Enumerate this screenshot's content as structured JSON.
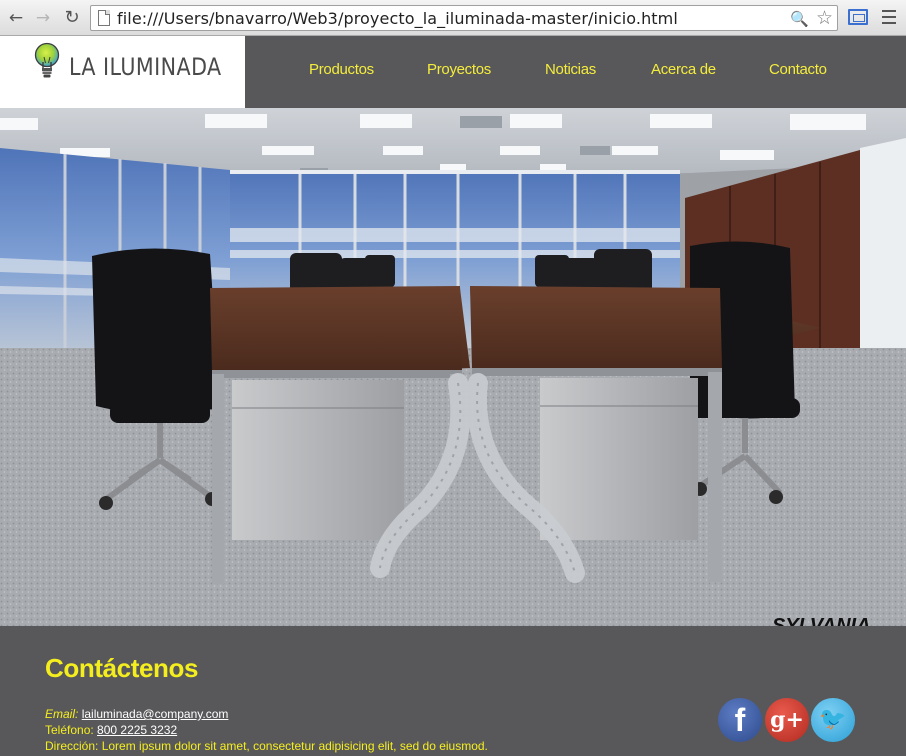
{
  "browser": {
    "url": "file:///Users/bnavarro/Web3/proyecto_la_iluminada-master/inicio.html",
    "icons": [
      "back-arrow-icon",
      "forward-arrow-icon",
      "reload-icon",
      "page-icon",
      "zoom-icon",
      "star-icon",
      "cast-icon",
      "menu-icon"
    ]
  },
  "header": {
    "logo_text": "LA ILUMINADA",
    "nav": [
      {
        "label": "Productos"
      },
      {
        "label": "Proyectos"
      },
      {
        "label": "Noticias"
      },
      {
        "label": "Acerca de"
      },
      {
        "label": "Contacto"
      }
    ],
    "link_color": "#f4ec3c"
  },
  "hero": {
    "watermark": "SYLVANIA"
  },
  "footer": {
    "title": "Contáctenos",
    "email_label": "Email:",
    "email_value": "lailuminada@company.com",
    "phone_label": "Teléfono:",
    "phone_value": "800 2225 3232",
    "address_label": "Dirección:",
    "address_value": "Lorem ipsum dolor sit amet, consectetur adipisicing elit, sed do eiusmod.",
    "social_glyphs": {
      "facebook": "f",
      "google_plus": "g+",
      "twitter": "🐦"
    },
    "accent_color": "#f5ee1f",
    "background_color": "#58585a"
  }
}
